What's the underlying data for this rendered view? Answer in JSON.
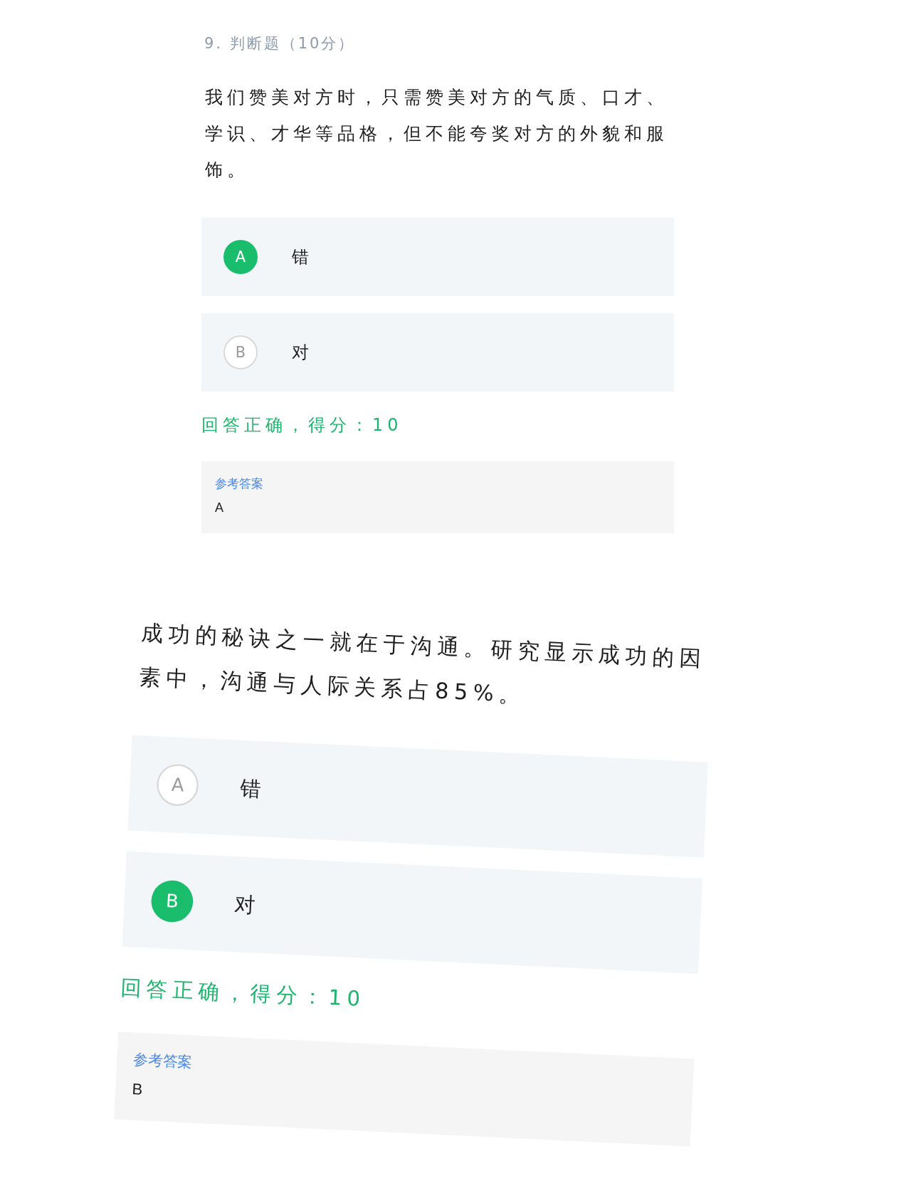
{
  "questions": [
    {
      "header": "9. 判断题（10分）",
      "text": "我们赞美对方时，只需赞美对方的气质、口才、学识、才华等品格，但不能夸奖对方的外貌和服饰。",
      "options": [
        {
          "letter": "A",
          "label": "错",
          "selected": true
        },
        {
          "letter": "B",
          "label": "对",
          "selected": false
        }
      ],
      "result": "回答正确，得分：10",
      "reference": {
        "label": "参考答案",
        "answer": "A"
      }
    },
    {
      "text": "成功的秘诀之一就在于沟通。研究显示成功的因素中，沟通与人际关系占85%。",
      "options": [
        {
          "letter": "A",
          "label": "错",
          "selected": false
        },
        {
          "letter": "B",
          "label": "对",
          "selected": true
        }
      ],
      "result": "回答正确，得分：10",
      "reference": {
        "label": "参考答案",
        "answer": "B"
      }
    }
  ]
}
